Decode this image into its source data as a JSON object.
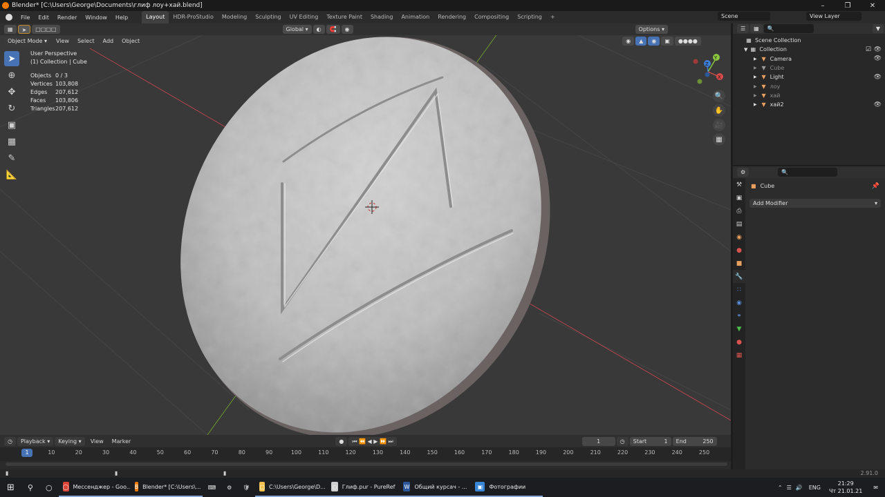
{
  "window": {
    "title": "Blender* [C:\\Users\\George\\Documents\\глиф лоу+хай.blend]"
  },
  "menu": [
    "File",
    "Edit",
    "Render",
    "Window",
    "Help"
  ],
  "workspaces": [
    "Layout",
    "HDR-ProStudio",
    "Modeling",
    "Sculpting",
    "UV Editing",
    "Texture Paint",
    "Shading",
    "Animation",
    "Rendering",
    "Compositing",
    "Scripting"
  ],
  "active_workspace": "Layout",
  "scene": {
    "name": "Scene",
    "view_layer": "View Layer"
  },
  "viewport": {
    "mode": "Object Mode",
    "menus": [
      "View",
      "Select",
      "Add",
      "Object"
    ],
    "orientation": "Global",
    "options": "Options",
    "perspective": "User Perspective",
    "collection_info": "(1) Collection | Cube",
    "stats": [
      {
        "k": "Objects",
        "v": "0 / 3"
      },
      {
        "k": "Vertices",
        "v": "103,808"
      },
      {
        "k": "Edges",
        "v": "207,612"
      },
      {
        "k": "Faces",
        "v": "103,806"
      },
      {
        "k": "Triangles",
        "v": "207,612"
      }
    ],
    "gizmo": {
      "x": "X",
      "y": "Y",
      "z": "Z"
    }
  },
  "outliner": {
    "root": "Scene Collection",
    "collection": "Collection",
    "items": [
      {
        "name": "Camera",
        "icon": "camera-icon",
        "color": "#e8a060",
        "dim": false,
        "eye": true
      },
      {
        "name": "Cube",
        "icon": "mesh-icon",
        "color": "#9a9a9a",
        "dim": true,
        "eye": false
      },
      {
        "name": "Light",
        "icon": "light-icon",
        "color": "#e8a060",
        "dim": false,
        "eye": true
      },
      {
        "name": "лоу",
        "icon": "mesh-icon",
        "color": "#e8a060",
        "dim": true,
        "eye": false
      },
      {
        "name": "хай",
        "icon": "mesh-icon",
        "color": "#e8a060",
        "dim": true,
        "eye": false
      },
      {
        "name": "хай2",
        "icon": "mesh-icon",
        "color": "#e8a060",
        "dim": false,
        "eye": true
      }
    ]
  },
  "properties": {
    "object_name": "Cube",
    "add_modifier": "Add Modifier"
  },
  "timeline": {
    "menus": [
      "Playback",
      "Keying",
      "View",
      "Marker"
    ],
    "current_frame": "1",
    "start_label": "Start",
    "start": "1",
    "end_label": "End",
    "end": "250",
    "ticks": [
      "10",
      "20",
      "30",
      "40",
      "50",
      "60",
      "70",
      "80",
      "90",
      "100",
      "110",
      "120",
      "130",
      "140",
      "150",
      "160",
      "170",
      "180",
      "190",
      "200",
      "210",
      "220",
      "230",
      "240",
      "250"
    ],
    "marker_frame": "1"
  },
  "status": {
    "version": "2.91.0"
  },
  "taskbar": {
    "items": [
      {
        "label": "Мессенджер - Goo...",
        "color": "#db4437"
      },
      {
        "label": "Blender* [C:\\Users\\...",
        "color": "#f57b00"
      },
      {
        "label": "C:\\Users\\George\\D...",
        "color": "#f2c14e"
      },
      {
        "label": "Глиф.pur - PureRef",
        "color": "#cfcfcf"
      },
      {
        "label": "Общий курсач - ...",
        "color": "#2b579a"
      },
      {
        "label": "Фотографии",
        "color": "#3a86d6"
      }
    ],
    "lang": "ENG",
    "time": "21:29",
    "date": "Чт 21.01.21"
  },
  "colors": {
    "accent": "#4772b3",
    "x_axis": "#d94b4b",
    "y_axis": "#8ac640",
    "z_axis": "#3d7fd9"
  }
}
